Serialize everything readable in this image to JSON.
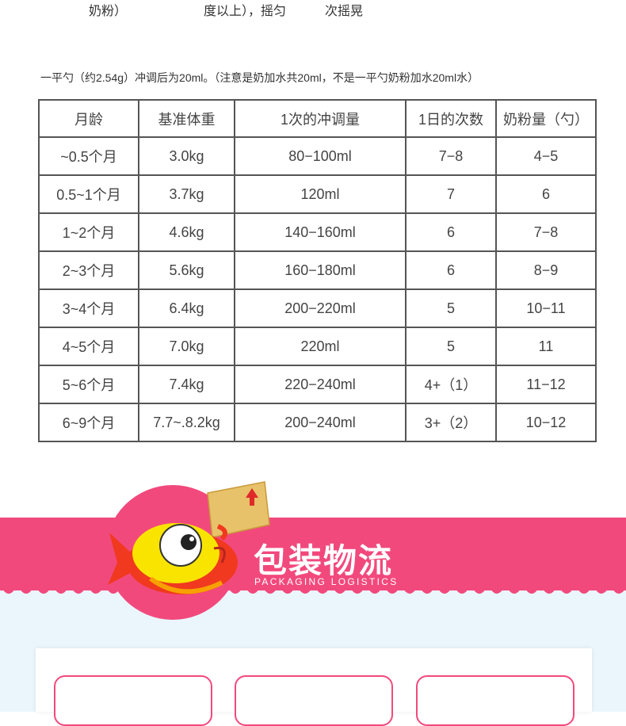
{
  "top_fragment": {
    "col1": "奶粉）",
    "col2": "度以上），摇匀",
    "col3": "次摇晃"
  },
  "note": "一平勺（约2.54g）冲调后为20ml。（注意是奶加水共20ml，不是一平勺奶粉加水20ml水）",
  "table": {
    "headers": [
      "月龄",
      "基准体重",
      "1次的冲调量",
      "1日的次数",
      "奶粉量（勺）"
    ],
    "rows": [
      [
        "~0.5个月",
        "3.0kg",
        "80−100ml",
        "7−8",
        "4−5"
      ],
      [
        "0.5~1个月",
        "3.7kg",
        "120ml",
        "7",
        "6"
      ],
      [
        "1~2个月",
        "4.6kg",
        "140−160ml",
        "6",
        "7−8"
      ],
      [
        "2~3个月",
        "5.6kg",
        "160−180ml",
        "6",
        "8−9"
      ],
      [
        "3~4个月",
        "6.4kg",
        "200−220ml",
        "5",
        "10−11"
      ],
      [
        "4~5个月",
        "7.0kg",
        "220ml",
        "5",
        "11"
      ],
      [
        "5~6个月",
        "7.4kg",
        "220−240ml",
        "4+（1）",
        "11−12"
      ],
      [
        "6~9个月",
        "7.7~.8.2kg",
        "200−240ml",
        "3+（2）",
        "10−12"
      ]
    ]
  },
  "banner": {
    "title": "包装物流",
    "subtitle": "PACKAGING LOGISTICS",
    "accent_color": "#f2497d"
  },
  "icons": {
    "mascot": "fish-mascot-icon",
    "box": "cardboard-box-icon",
    "arrow": "up-arrow-icon"
  }
}
